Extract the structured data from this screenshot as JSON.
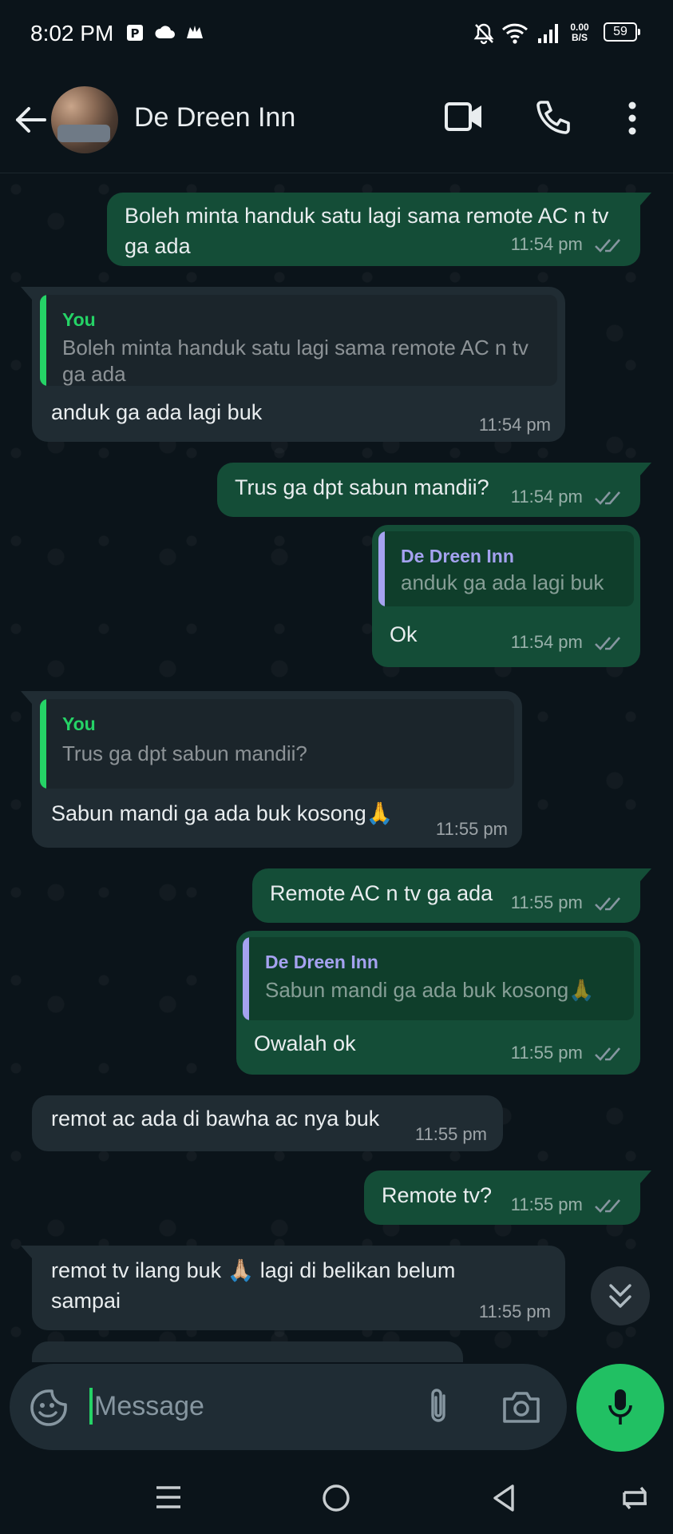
{
  "status_bar": {
    "time": "8:02 PM",
    "net_speed_value": "0.00",
    "net_speed_unit": "B/S",
    "battery": "59"
  },
  "header": {
    "title": "De Dreen Inn",
    "icons": [
      "back-arrow-icon",
      "video-call-icon",
      "voice-call-icon",
      "more-options-icon"
    ]
  },
  "messages": [
    {
      "dir": "out",
      "text": "Boleh minta handuk satu lagi sama remote AC n tv ga ada",
      "time": "11:54 pm",
      "status": "read"
    },
    {
      "dir": "in",
      "quote_author": "You",
      "quote_text": "Boleh minta handuk satu lagi sama remote AC n tv ga ada",
      "text": "anduk ga ada lagi buk",
      "time": "11:54 pm"
    },
    {
      "dir": "out",
      "text": "Trus ga dpt sabun mandii?",
      "time": "11:54 pm",
      "status": "read"
    },
    {
      "dir": "out",
      "quote_author": "De Dreen Inn",
      "quote_text": "anduk ga ada lagi buk",
      "text": "Ok",
      "time": "11:54 pm",
      "status": "read"
    },
    {
      "dir": "in",
      "quote_author": "You",
      "quote_text": "Trus ga dpt sabun mandii?",
      "text": "Sabun mandi ga ada buk kosong🙏",
      "time": "11:55 pm"
    },
    {
      "dir": "out",
      "text": "Remote AC n tv ga ada",
      "time": "11:55 pm",
      "status": "read"
    },
    {
      "dir": "out",
      "quote_author": "De Dreen Inn",
      "quote_text": "Sabun mandi ga ada buk kosong🙏",
      "text": "Owalah ok",
      "time": "11:55 pm",
      "status": "read"
    },
    {
      "dir": "in",
      "text": "remot ac ada di bawha ac nya buk",
      "time": "11:55 pm"
    },
    {
      "dir": "out",
      "text": "Remote tv?",
      "time": "11:55 pm",
      "status": "read"
    },
    {
      "dir": "in",
      "text": "remot tv ilang buk 🙏🏼 lagi di belikan belum sampai",
      "time": "11:55 pm"
    }
  ],
  "composer": {
    "placeholder": "Message",
    "icons": [
      "sticker-icon",
      "attach-icon",
      "camera-icon",
      "mic-icon"
    ]
  },
  "colors": {
    "background": "#0b141a",
    "outgoing_bubble": "#144d37",
    "incoming_bubble": "#202c33",
    "accent": "#21c063",
    "quote_you": "#25d366",
    "quote_contact": "#a5a2f0",
    "read_ticks": "#8696a0"
  }
}
